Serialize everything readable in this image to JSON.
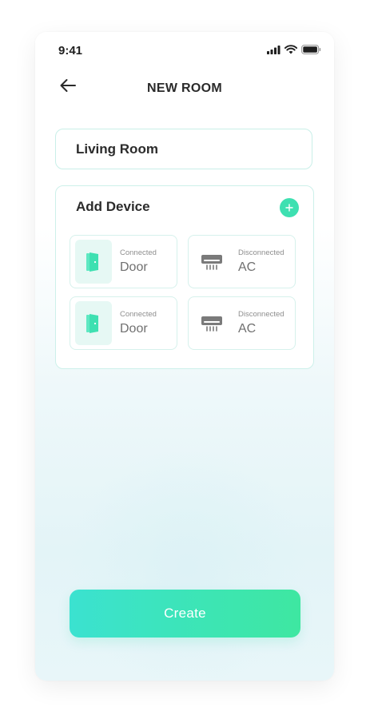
{
  "status_bar": {
    "time": "9:41"
  },
  "header": {
    "title": "NEW ROOM",
    "back_icon": "arrow-left-icon"
  },
  "room_name": {
    "value": "Living Room"
  },
  "devices_panel": {
    "title": "Add Device",
    "add_icon": "plus-icon",
    "devices": [
      {
        "status": "Connected",
        "name": "Door",
        "icon": "door-icon"
      },
      {
        "status": "Disconnected",
        "name": "AC",
        "icon": "air-conditioner-icon"
      },
      {
        "status": "Connected",
        "name": "Door",
        "icon": "door-icon"
      },
      {
        "status": "Disconnected",
        "name": "AC",
        "icon": "air-conditioner-icon"
      }
    ]
  },
  "create_button": {
    "label": "Create"
  },
  "colors": {
    "accent": "#3ee0b1",
    "accent_gradient_start": "#3be2d0",
    "accent_gradient_end": "#3ee7a1",
    "text_dark": "#2b2b2b",
    "text_muted": "#8e8e8e"
  }
}
